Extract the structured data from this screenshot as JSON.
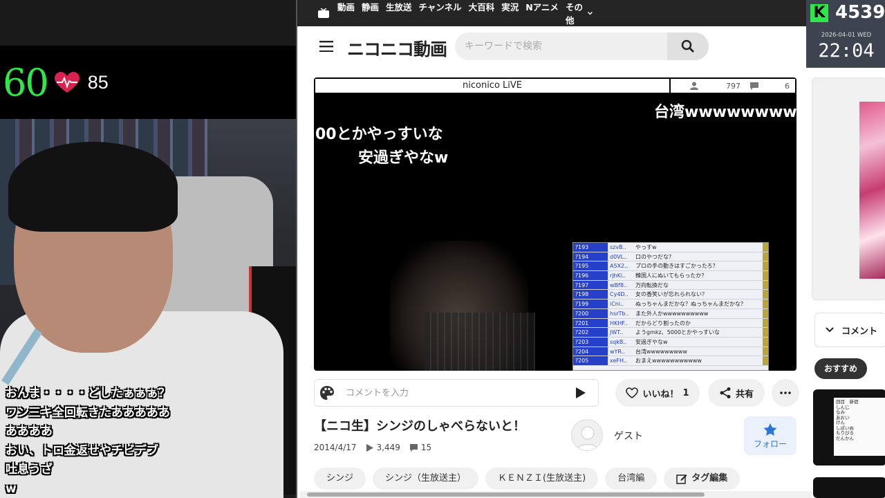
{
  "stream": {
    "heart_rate": "60",
    "bpm": "85",
    "comments": [
      "おんま・・・・どしたぁぁぁ？",
      "ワン三キ全回転きたあああああ",
      "ああああ",
      "おい、トロ金返せやチビデブ",
      "吐息うざ",
      "w"
    ]
  },
  "topnav": {
    "items": [
      "動画",
      "静画",
      "生放送",
      "チャンネル",
      "大百科",
      "実況",
      "Nアニメ"
    ],
    "more": "その他"
  },
  "header": {
    "logo": "ニコニコ動画",
    "search_placeholder": "キーワードで検索"
  },
  "overlay": {
    "k_letter": "K",
    "k_number": "4539",
    "date": "2026-04-01 WED",
    "time": "22:04"
  },
  "player": {
    "brand": "niconico LiVE",
    "viewers": "797",
    "comments_count": "6",
    "flowing": [
      "台湾wwwwwwwww",
      "00とかやっすいな",
      "安過ぎやなw"
    ],
    "comment_list": [
      {
        "no": "ｱ193",
        "id": "szvB..",
        "text": "やっすw"
      },
      {
        "no": "ｱ194",
        "id": "d0VL..",
        "text": "口のやつだな？"
      },
      {
        "no": "ｱ195",
        "id": "A5X2..",
        "text": "プロの手の動きはすごかったろ？"
      },
      {
        "no": "ｱ196",
        "id": "rjhKi..",
        "text": "韓国人にぬいてもらったか？"
      },
      {
        "no": "ｱ197",
        "id": "wBf8..",
        "text": "万向転換だな"
      },
      {
        "no": "ｱ198",
        "id": "Cy4D..",
        "text": "女の香笑いが忘れられない？"
      },
      {
        "no": "ｱ199",
        "id": "iCni..",
        "text": "ぬっちゃんまだかな？ぬっちゃんまだかな？"
      },
      {
        "no": "ｱ200",
        "id": "hsrTb..",
        "text": "また外人かwwwwwwwwww"
      },
      {
        "no": "ｱ201",
        "id": "HKHF..",
        "text": "だからどり割ったのか"
      },
      {
        "no": "ｱ202",
        "id": "JWT..",
        "text": "ようgmkz、5000とかやっすいな"
      },
      {
        "no": "ｱ203",
        "id": "sqkB..",
        "text": "安過ぎやなw"
      },
      {
        "no": "ｱ204",
        "id": "wYR..",
        "text": "台湾wwwwwwwww"
      },
      {
        "no": "ｱ205",
        "id": "xeFH..",
        "text": "おまえwwwwwwwwwww"
      }
    ]
  },
  "controls": {
    "comment_placeholder": "コメントを入力",
    "like_label": "いいね！",
    "like_count": "1",
    "share_label": "共有"
  },
  "video": {
    "title": "【ニコ生】シンジのしゃべらないと！",
    "date": "2014/4/17",
    "views": "3,449",
    "comments": "15",
    "uploader": "ゲスト",
    "follow_label": "フォロー",
    "tags": [
      "シンジ",
      "シンジ（生放送主）",
      "ＫＥＮＺＩ(生放送主)",
      "台湾編"
    ],
    "tag_edit": "タグ編集"
  },
  "sidebar": {
    "comments_label": "コメント",
    "recommend_label": "おすすめ",
    "thumb_text": [
      "回目　新宿",
      "しんじ",
      "なみ",
      "あおい",
      "けん",
      "しぽいぬ",
      "もりぴる",
      "だんかん"
    ]
  },
  "colors": {
    "heart_rate": "#2ee84a",
    "accent_blue": "#2b77d8",
    "topbar": "#252525"
  }
}
